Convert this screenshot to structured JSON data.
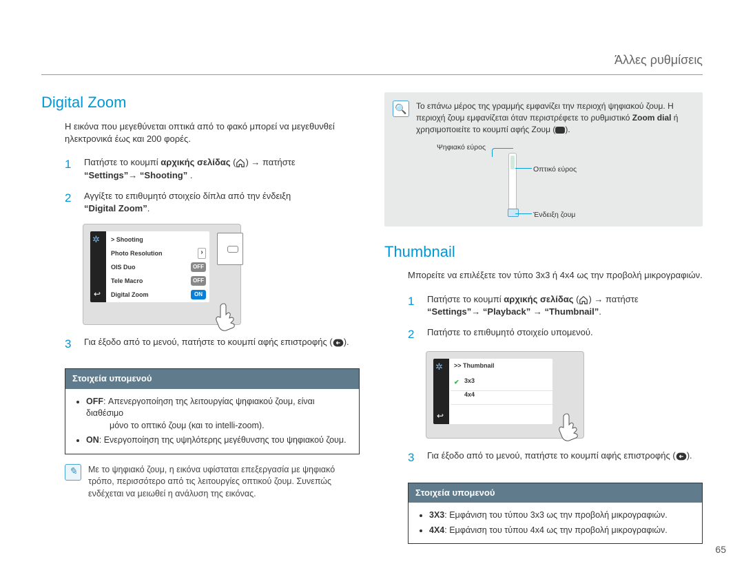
{
  "header": {
    "breadcrumb": "Άλλες ρυθμίσεις"
  },
  "left": {
    "title": "Digital Zoom",
    "intro": "Η εικόνα που μεγεθύνεται οπτικά από το φακό μπορεί να μεγεθυνθεί ηλεκτρονικά έως και 200 φορές.",
    "step1_a": "Πατήστε το κουμπί ",
    "step1_bold": "αρχικής σελίδας",
    "step1_b": " (",
    "step1_c": ") → πατήστε ",
    "step1_path": "“Settings”→ “Shooting”",
    "step1_d": " .",
    "step2_a": "Αγγίξτε το επιθυμητό στοιχείο δίπλα από την ένδειξη ",
    "step2_bold": "“Digital Zoom”",
    "step2_b": ".",
    "screen": {
      "path": ">  Shooting",
      "row1": "Photo Resolution",
      "row2": "OIS Duo",
      "row3": "Tele Macro",
      "row4": "Digital Zoom",
      "off": "OFF",
      "on": "ON"
    },
    "step3_a": "Για έξοδο από το μενού, πατήστε το κουμπί αφής επιστροφής (",
    "step3_b": ").",
    "submenu": {
      "title": "Στοιχεία υπομενού",
      "off_label": "OFF",
      "off_text": ": Απενεργοποίηση της λειτουργίας ψηφιακού ζουμ, είναι διαθέσιμο",
      "off_text2": "μόνο το οπτικό ζουμ (και το intelli-zoom).",
      "on_label": "ON",
      "on_text": ": Ενεργοποίηση της υψηλότερης μεγέθυνσης του ψηφιακού ζουμ."
    },
    "note": "Με το ψηφιακό ζουμ, η εικόνα υφίσταται επεξεργασία με ψηφιακό τρόπο, περισσότερο από τις λειτουργίες οπτικού ζουμ. Συνεπώς ενδέχεται να μειωθεί η ανάλυση της εικόνας."
  },
  "right": {
    "info_a": "Το επάνω μέρος της γραμμής εμφανίζει την περιοχή ψηφιακού ζουμ. Η περιοχή ζουμ εμφανίζεται όταν περιστρέφετε το ρυθμιστικό ",
    "info_b": "Zoom dial",
    "info_c": " ή χρησιμοποιείτε το κουμπί αφής Ζουμ (",
    "info_d": ").",
    "zoom_labels": {
      "digital": "Ψηφιακό εύρος",
      "optical": "Οπτικό εύρος",
      "indicator": "Ένδειξη ζουμ"
    },
    "title": "Thumbnail",
    "intro": "Μπορείτε να επιλέξετε τον τύπο 3x3 ή 4x4 ως την προβολή μικρογραφιών.",
    "step1_a": "Πατήστε το κουμπί ",
    "step1_bold": "αρχικής σελίδας",
    "step1_b": " (",
    "step1_c": ") → πατήστε ",
    "step1_path": "“Settings”→ “Playback” → “Thumbnail”",
    "step1_d": ".",
    "step2": "Πατήστε το επιθυμητό στοιχείο υπομενού.",
    "screen": {
      "path": ">> Thumbnail",
      "opt1": "3x3",
      "opt2": "4x4"
    },
    "step3_a": "Για έξοδο από το μενού, πατήστε το κουμπί αφής επιστροφής (",
    "step3_b": ").",
    "submenu": {
      "title": "Στοιχεία υπομενού",
      "a_label": "3X3",
      "a_text": ": Εμφάνιση του τύπου 3x3 ως την προβολή μικρογραφιών.",
      "b_label": "4X4",
      "b_text": ": Εμφάνιση του τύπου 4x4 ως την προβολή μικρογραφιών."
    }
  },
  "pagenum": "65"
}
